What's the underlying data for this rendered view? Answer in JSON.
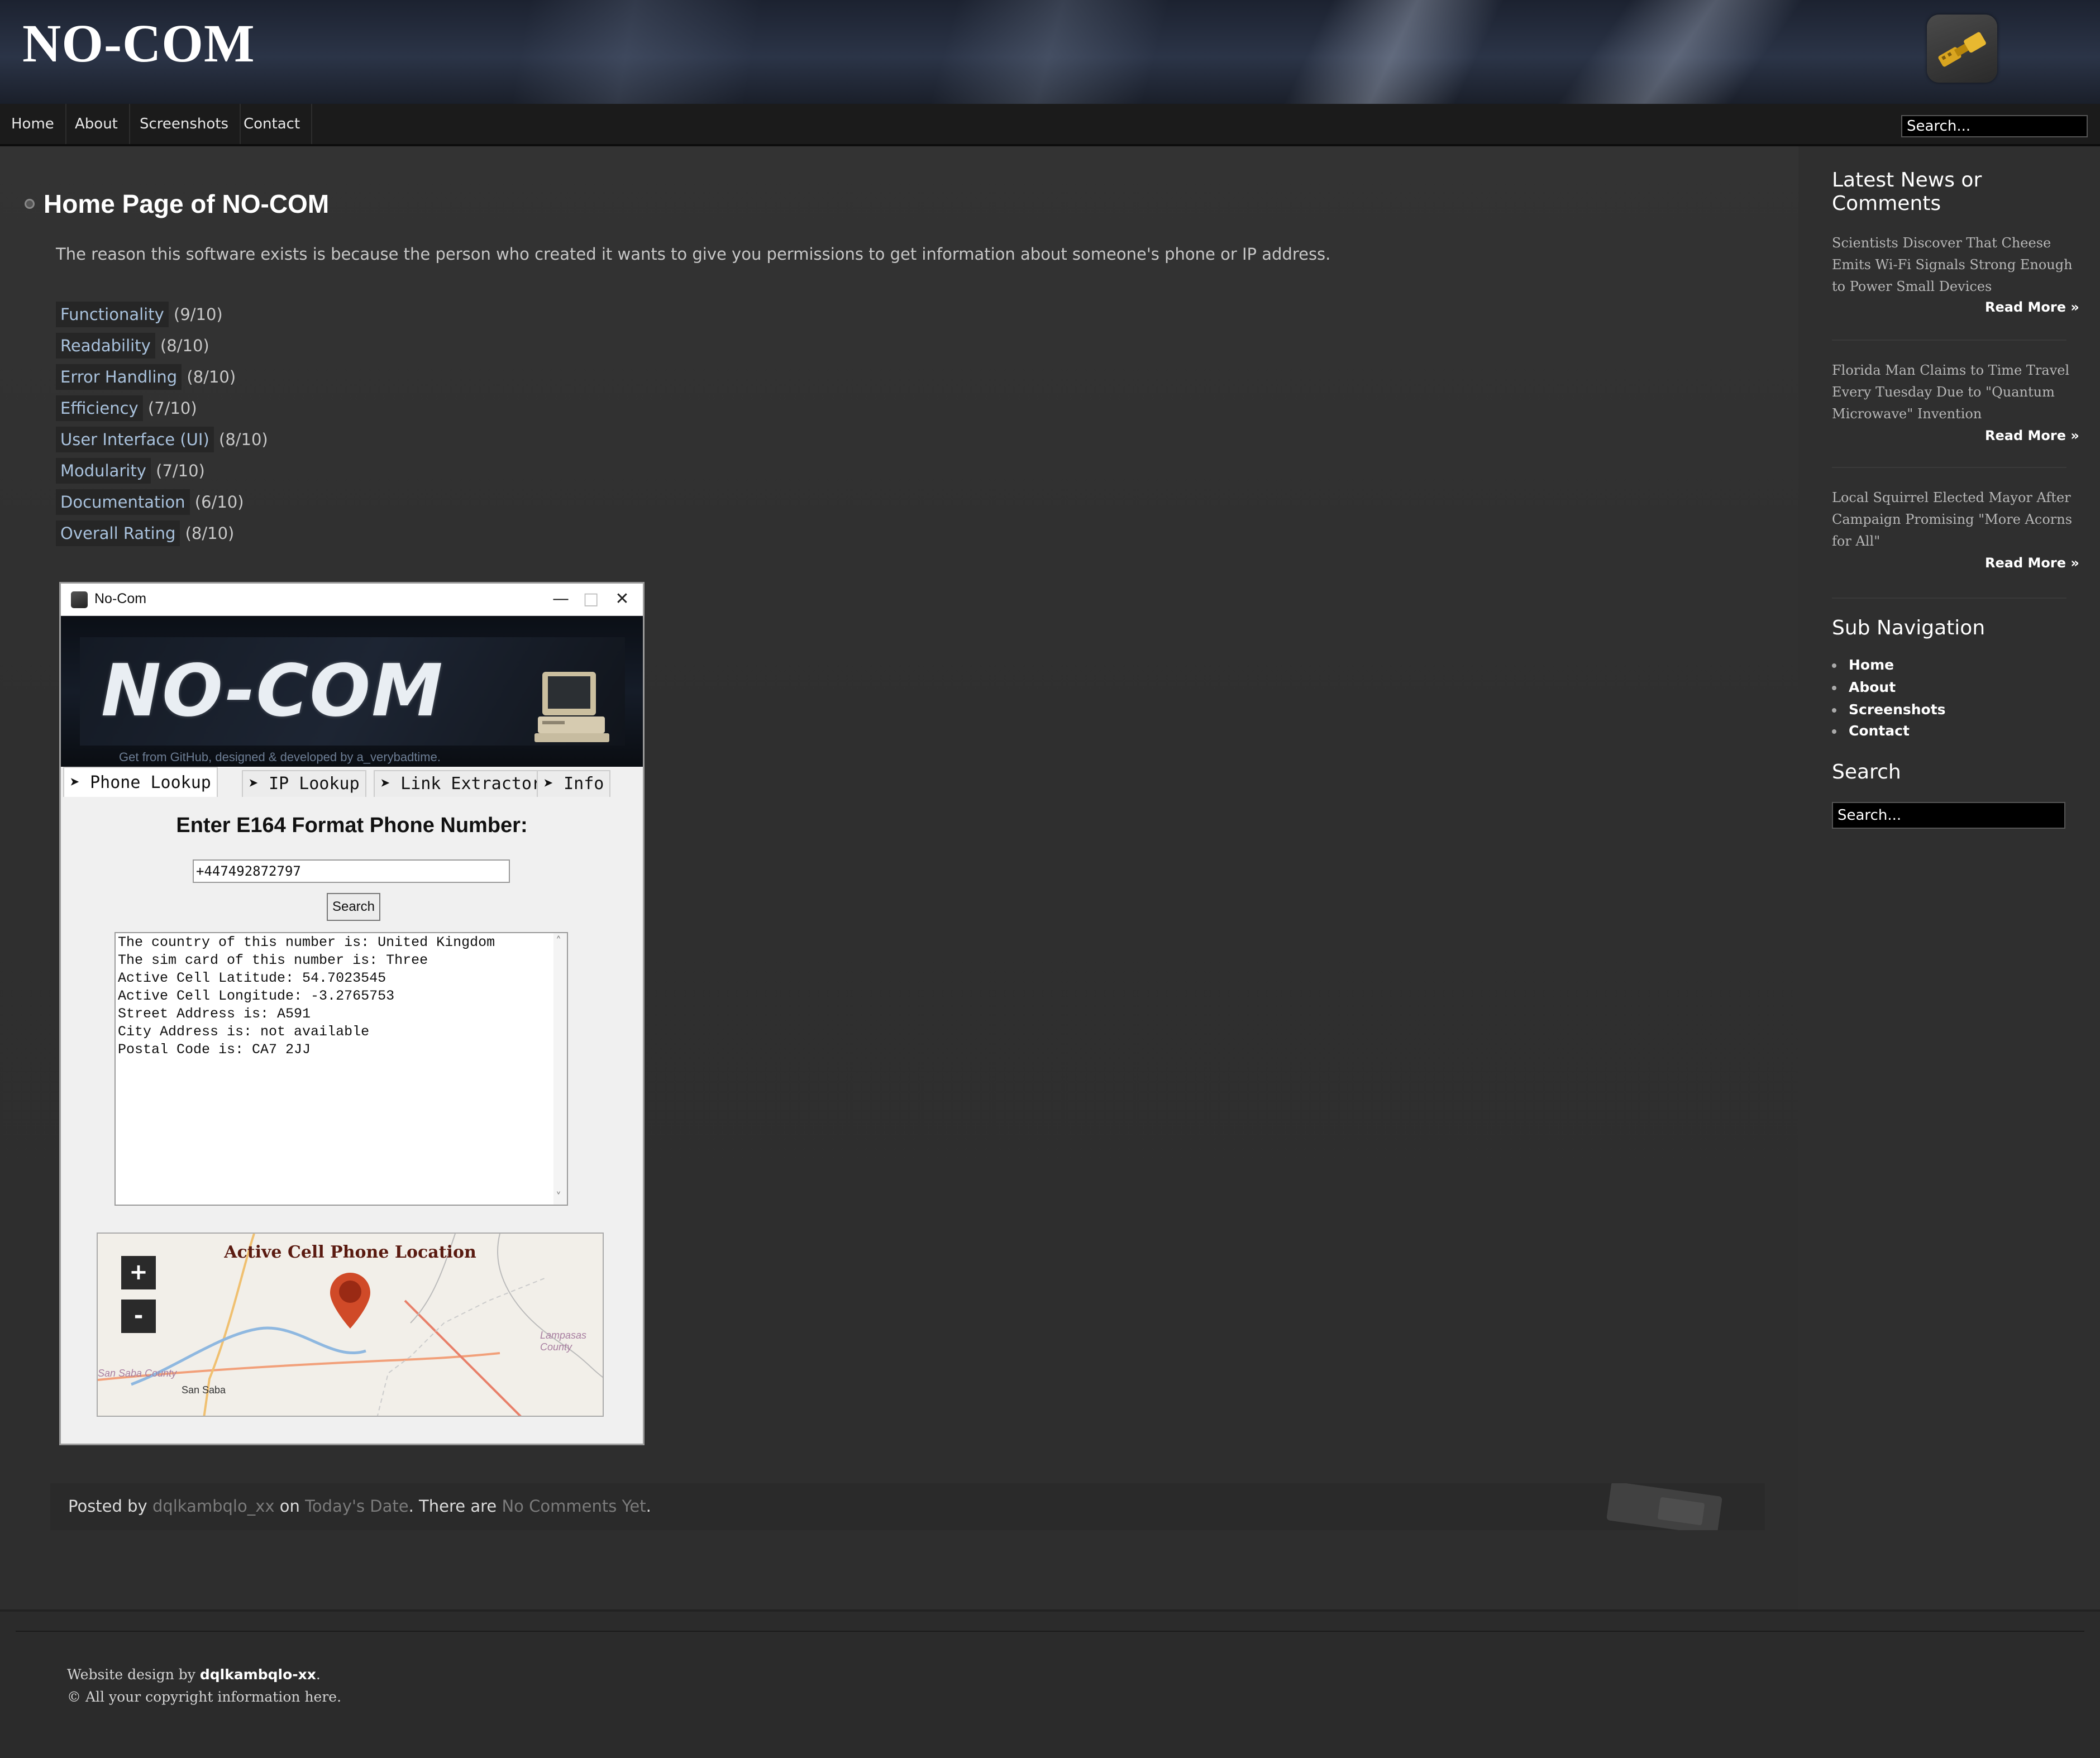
{
  "header": {
    "site_title": "NO-COM",
    "logo_icon": "gold-usb-cable-icon"
  },
  "nav": {
    "items": [
      "Home",
      "About",
      "Screenshots",
      "Contact"
    ],
    "search_placeholder": "Search..."
  },
  "main": {
    "title": "Home Page of NO-COM",
    "intro": "The reason this software exists is because the person who created it wants to give you permissions to get information about someone's phone or IP address.",
    "ratings": [
      {
        "label": "Functionality",
        "score": "(9/10)"
      },
      {
        "label": "Readability",
        "score": "(8/10)"
      },
      {
        "label": "Error Handling",
        "score": "(8/10)"
      },
      {
        "label": "Efficiency",
        "score": "(7/10)"
      },
      {
        "label": "User Interface (UI)",
        "score": "(8/10)"
      },
      {
        "label": "Modularity",
        "score": "(7/10)"
      },
      {
        "label": "Documentation",
        "score": "(6/10)"
      },
      {
        "label": "Overall Rating",
        "score": "(8/10)"
      }
    ]
  },
  "app": {
    "window_title": "No-Com",
    "window_controls": {
      "minimize": "—",
      "maximize": "□",
      "close": "✕"
    },
    "banner_logo": "NO-COM",
    "banner_subtitle": "Get from GitHub, designed & developed by a_verybadtime.",
    "tabs": [
      "➤ Phone Lookup",
      "➤ IP Lookup",
      "➤ Link Extractor",
      "➤ Info"
    ],
    "active_tab": "➤ Phone Lookup",
    "heading": "Enter E164 Format Phone Number:",
    "phone_value": "+447492872797",
    "search_label": "Search",
    "output_lines": [
      "The country of this number is: United Kingdom",
      "The sim card of this number is: Three",
      "Active Cell Latitude: 54.7023545",
      "Active Cell Longitude: -3.2765753",
      "Street Address is: A591",
      "City Address is: not available",
      "Postal Code is: CA7 2JJ"
    ],
    "map": {
      "title": "Active Cell Phone Location",
      "zoom_in": "+",
      "zoom_out": "-",
      "labels": {
        "lampasas": "Lampasas County",
        "sansaba_county": "San Saba County",
        "sansaba": "San Saba"
      }
    }
  },
  "posted": {
    "prefix": "Posted by ",
    "author": "dqlkambqlo_xx",
    "on": " on ",
    "date": "Today's Date",
    "there_are": ". There are ",
    "comments": "No Comments Yet",
    "suffix": "."
  },
  "sidebar": {
    "news_heading": "Latest News or Comments",
    "news": [
      {
        "text": "Scientists Discover That Cheese Emits Wi-Fi Signals Strong Enough to Power Small Devices",
        "link": "Read More »"
      },
      {
        "text": "Florida Man Claims to Time Travel Every Tuesday Due to \"Quantum Microwave\" Invention",
        "link": "Read More »"
      },
      {
        "text": "Local Squirrel Elected Mayor After Campaign Promising \"More Acorns for All\"",
        "link": "Read More »"
      }
    ],
    "subnav_heading": "Sub Navigation",
    "subnav": [
      "Home",
      "About",
      "Screenshots",
      "Contact"
    ],
    "search_heading": "Search",
    "search_placeholder": "Search..."
  },
  "footer": {
    "design_prefix": "Website design by ",
    "designer": "dqlkambqlo-xx",
    "design_suffix": ".",
    "copyright": "© All your copyright information here."
  }
}
